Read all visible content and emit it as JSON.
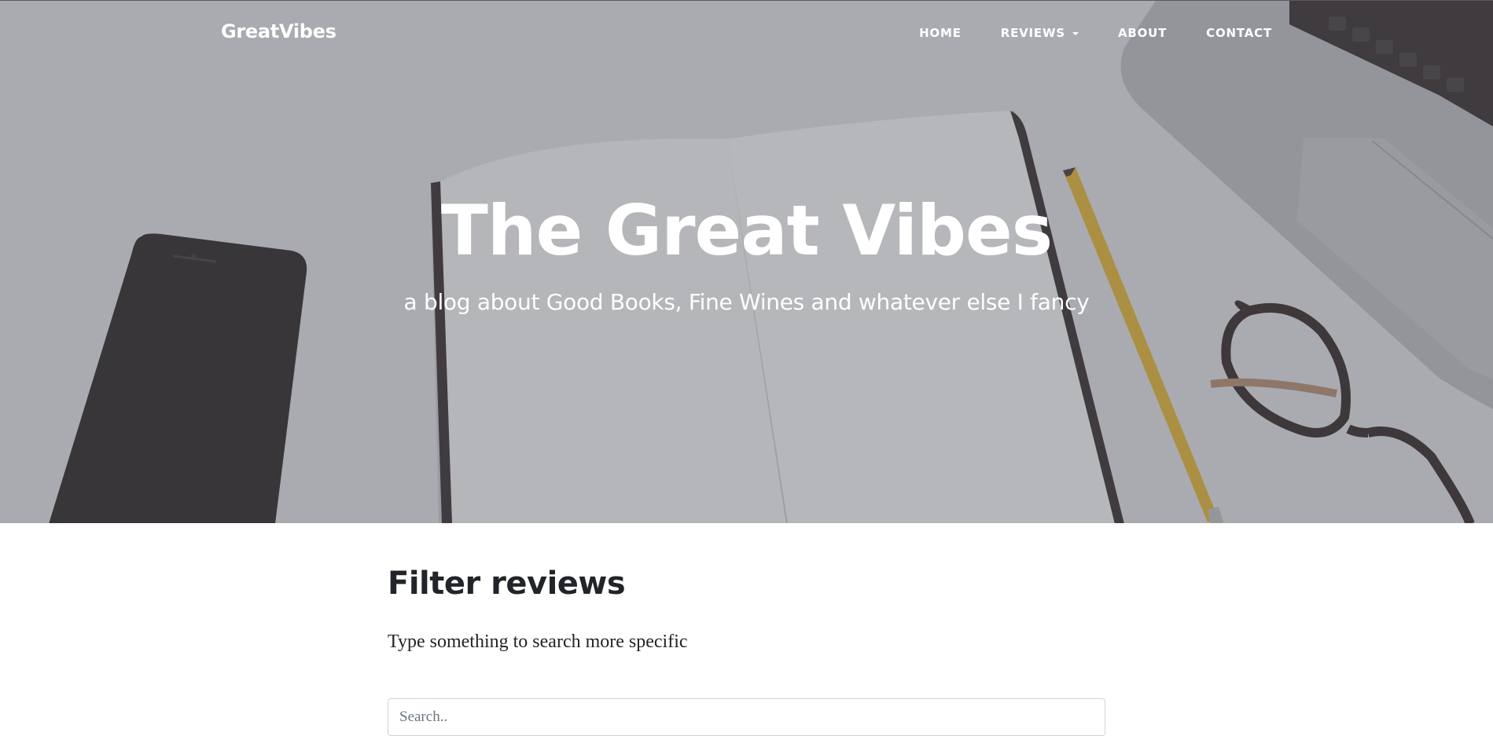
{
  "nav": {
    "brand": "GreatVibes",
    "links": [
      {
        "label": "HOME"
      },
      {
        "label": "REVIEWS"
      },
      {
        "label": "ABOUT"
      },
      {
        "label": "CONTACT"
      }
    ]
  },
  "hero": {
    "title": "The Great Vibes",
    "subtitle": "a blog about Good Books, Fine Wines and whatever else I fancy"
  },
  "filter": {
    "heading": "Filter reviews",
    "description": "Type something to search more specific",
    "search_placeholder": "Search.."
  },
  "colors": {
    "text_dark": "#212529",
    "nav_text": "#ffffff"
  },
  "icons": [
    "dropdown-caret-icon"
  ]
}
